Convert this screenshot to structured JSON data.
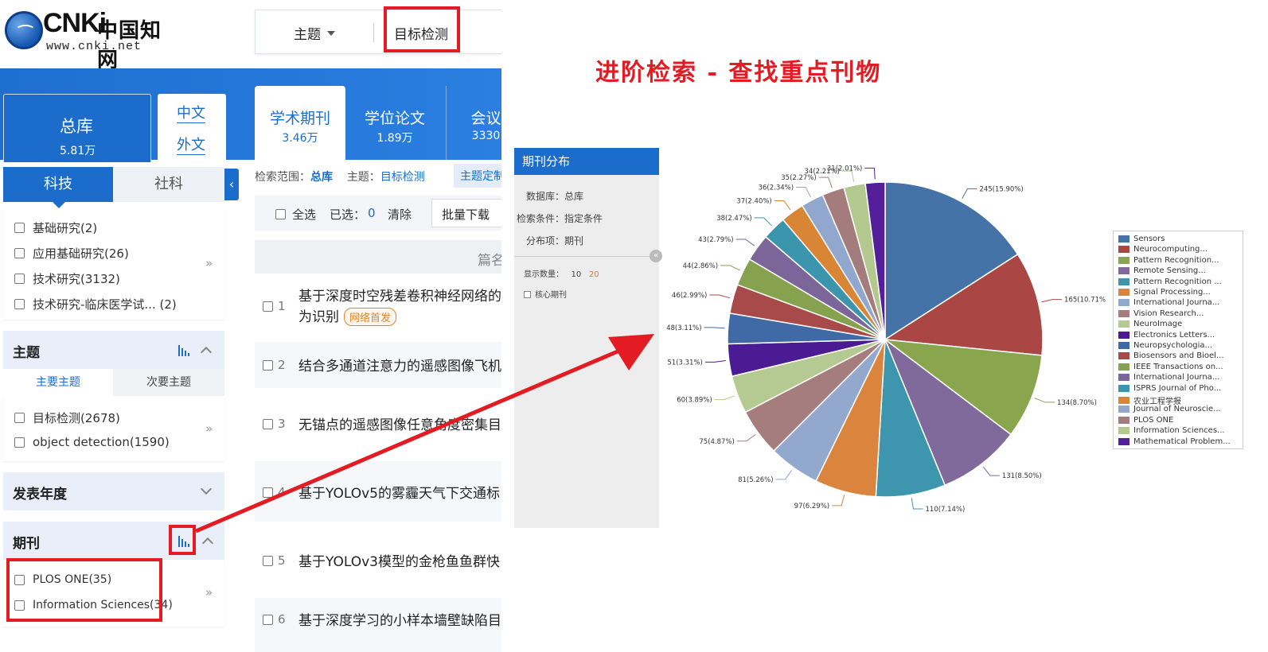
{
  "heading": "进阶检索 - 查找重点刊物",
  "logo": {
    "brand": "CNKi",
    "cn": "中国知网",
    "url": "www.cnki.net"
  },
  "search": {
    "field": "主题",
    "query": "目标检测"
  },
  "db_tab": {
    "name": "总库",
    "count": "5.81万"
  },
  "lang": {
    "zh": "中文",
    "en": "外文"
  },
  "resource_tabs": [
    {
      "name": "学术期刊",
      "count": "3.46万"
    },
    {
      "name": "学位论文",
      "count": "1.89万"
    },
    {
      "name": "会议",
      "count": "3330"
    }
  ],
  "sidebar": {
    "seg_on": "科技",
    "seg_off": "社科",
    "collapse": "‹",
    "level_items": [
      "基础研究(2)",
      "应用基础研究(26)",
      "技术研究(3132)",
      "技术研究-临床医学试... (2)"
    ],
    "more": "»",
    "topic": {
      "title": "主题",
      "tab_main": "主要主题",
      "tab_sub": "次要主题",
      "items": [
        "目标检测(2678)",
        "object detection(1590)"
      ]
    },
    "year": {
      "title": "发表年度"
    },
    "journal": {
      "title": "期刊",
      "items": [
        "PLOS ONE(35)",
        "Information Sciences(34)"
      ]
    }
  },
  "scope": {
    "label": "检索范围：",
    "value": "总库",
    "topic_label": "主题：",
    "topic_value": "目标检测",
    "topic_btn": "主题定制"
  },
  "actions": {
    "select_all": "全选",
    "selected": "已选：",
    "selected_count": "0",
    "clear": "清除",
    "batch_download": "批量下载"
  },
  "list_header": "篇名",
  "results": [
    {
      "num": "1",
      "title": "基于深度时空残差卷积神经网络的",
      "title2": "为识别",
      "badge": "网络首发"
    },
    {
      "num": "2",
      "title": "结合多通道注意力的遥感图像飞机"
    },
    {
      "num": "3",
      "title": "无锚点的遥感图像任意角度密集目"
    },
    {
      "num": "4",
      "title": "基于YOLOv5的雾霾天气下交通标"
    },
    {
      "num": "5",
      "title": "基于YOLOv3模型的金枪鱼鱼群快"
    },
    {
      "num": "6",
      "title": "基于深度学习的小样本墙壁缺陷目"
    }
  ],
  "jpanel": {
    "title": "期刊分布",
    "db": "数据库：总库",
    "cond": "检索条件：指定条件",
    "item": "分布项：期刊",
    "show_label": "显示数量：",
    "show_10": "10",
    "show_20": "20",
    "core": "核心期刊",
    "toggle": "«"
  },
  "chart_data": {
    "type": "pie",
    "labels": [
      "Sensors",
      "Neurocomputing...",
      "Pattern Recognition...",
      "Remote Sensing...",
      "Pattern Recognition ...",
      "Signal Processing...",
      "International Journa...",
      "Vision Research...",
      "NeuroImage",
      "Electronics Letters...",
      "Neuropsychologia...",
      "Biosensors and Bioel...",
      "IEEE Transactions on...",
      "International Journa...",
      "ISPRS Journal of Pho...",
      "农业工程学报",
      "Journal of Neuroscie...",
      "PLOS ONE",
      "Information Sciences...",
      "Mathematical Problem..."
    ],
    "values": [
      245,
      165,
      134,
      131,
      110,
      97,
      81,
      75,
      60,
      51,
      48,
      46,
      44,
      43,
      38,
      37,
      36,
      35,
      34,
      31
    ],
    "data_labels": [
      "245(15.90%)",
      "165(10.71%)",
      "134(8.70%)",
      "131(8.50%)",
      "110(7.14%)",
      "97(6.29%)",
      "81(5.26%)",
      "75(4.87%)",
      "60(3.89%)",
      "51(3.31%)",
      "48(3.11%)",
      "46(2.99%)",
      "44(2.86%)",
      "43(2.79%)",
      "38(2.47%)",
      "37(2.40%)",
      "36(2.34%)",
      "35(2.27%)",
      "34(2.21%)",
      "31(2.01%)"
    ],
    "colors": [
      "#4572a7",
      "#aa4643",
      "#89a54e",
      "#80699b",
      "#3d96ae",
      "#db843d",
      "#92a8cd",
      "#a47d7c",
      "#b5ca92",
      "#4b1b94",
      "#3f6aa6",
      "#a84a4a",
      "#86a24e",
      "#7b6599",
      "#3b95ad",
      "#d98536",
      "#91a7cd",
      "#a37c7b",
      "#b3c98f",
      "#53209a"
    ],
    "legend_position": "right"
  },
  "colors": {
    "accent": "#1c6ccb",
    "highlight": "#e31b23",
    "badge": "#e0862a"
  }
}
